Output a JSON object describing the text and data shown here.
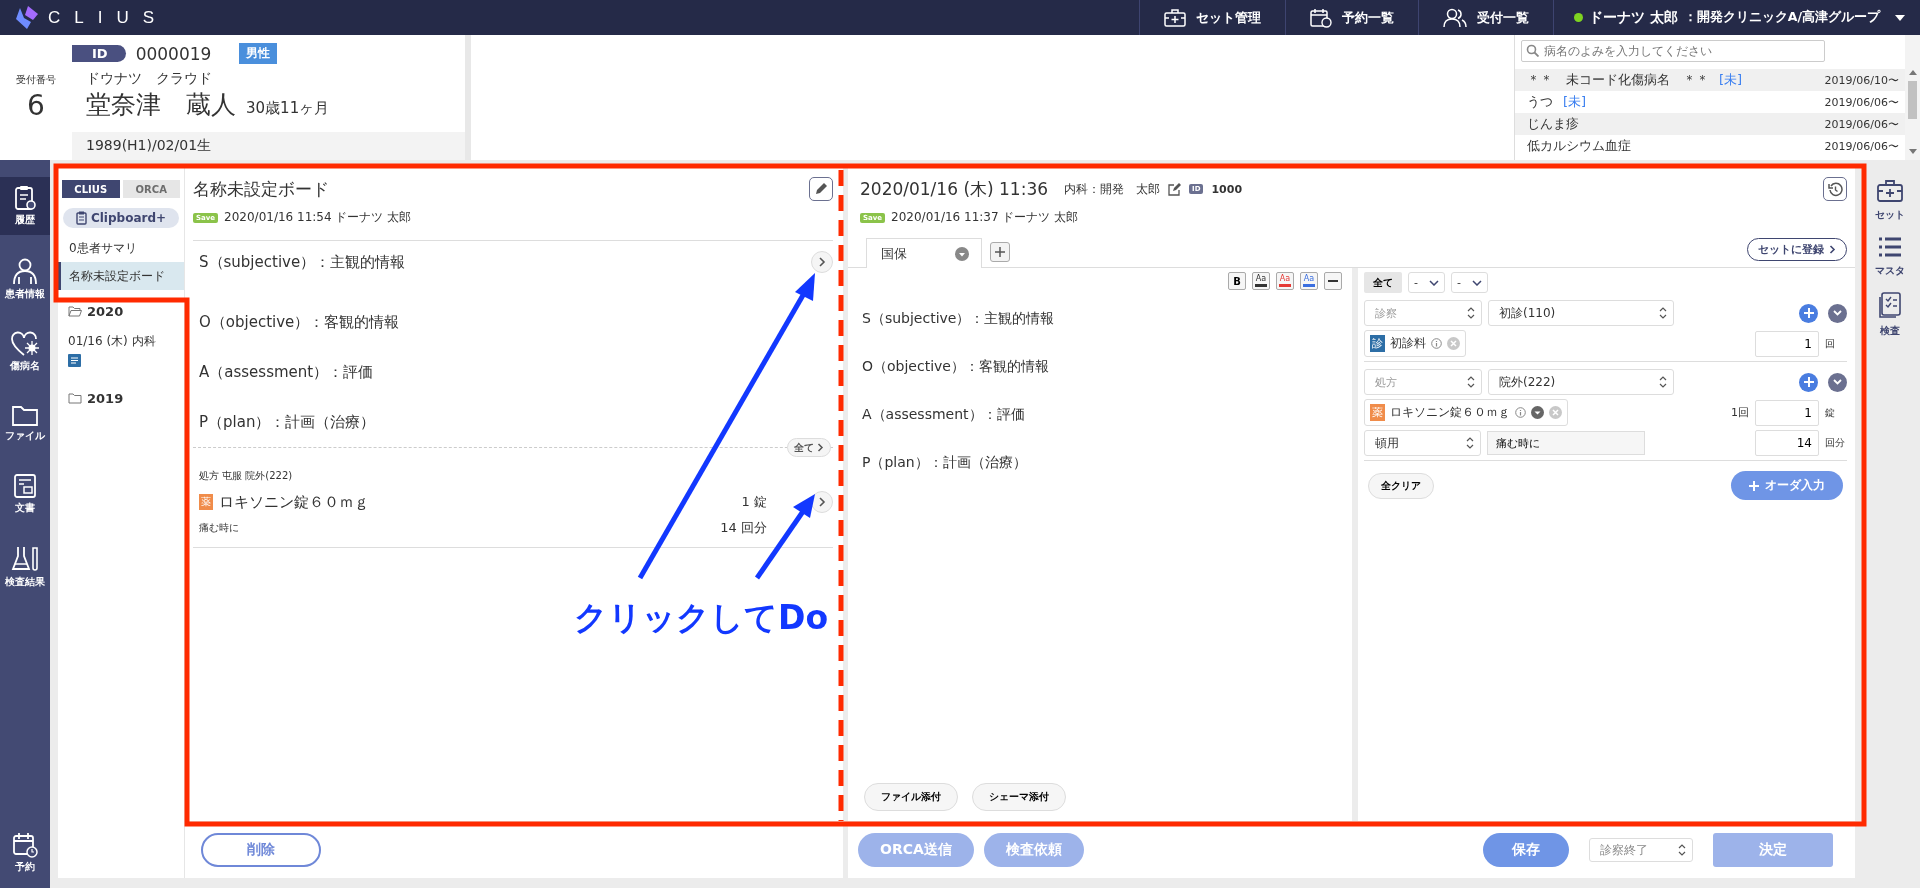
{
  "top_bar": {
    "logo": "CLIUS",
    "nav": [
      {
        "label": "セット管理",
        "kind": "kit"
      },
      {
        "label": "予約一覧",
        "kind": "calendar"
      },
      {
        "label": "受付一覧",
        "kind": "people"
      }
    ],
    "user": {
      "name": "ドーナツ 太郎",
      "affiliation": "：開発クリニックA/高津グループ",
      "online": true
    }
  },
  "header": {
    "receipt": {
      "label": "受付番号",
      "number": "6"
    },
    "patient": {
      "id_label": "ID",
      "id": "0000019",
      "sex": "男性",
      "kana": "ドウナツ　クラウド",
      "name": "堂奈津　蔵人",
      "age": "30歳11ヶ月",
      "birth": "1989(H1)/02/01生"
    },
    "diseases": {
      "placeholder": "病名のよみを入力してください",
      "rows": [
        {
          "name": "＊＊　未コード化傷病名　＊＊",
          "tag": "[未]",
          "date": "2019/06/10〜"
        },
        {
          "name": "うつ",
          "tag": "[未]",
          "date": "2019/06/06〜"
        },
        {
          "name": "じんま疹",
          "date": "2019/06/06〜"
        },
        {
          "name": "低カルシウム血症",
          "date": "2019/06/06〜"
        }
      ]
    }
  },
  "left_nav": {
    "items": [
      {
        "label": "履歴",
        "kind": "history",
        "selected": true
      },
      {
        "label": "患者情報",
        "kind": "patient",
        "selected": false
      },
      {
        "label": "傷病名",
        "kind": "disease",
        "selected": false
      },
      {
        "label": "ファイル",
        "kind": "folder",
        "selected": false
      },
      {
        "label": "文書",
        "kind": "document",
        "selected": false
      },
      {
        "label": "検査結果",
        "kind": "lab",
        "selected": false
      }
    ],
    "bottom": {
      "label": "予約",
      "kind": "calendar"
    }
  },
  "history_panel": {
    "tabs": [
      {
        "label": "CLIUS",
        "selected": true
      },
      {
        "label": "ORCA",
        "selected": false
      }
    ],
    "clipboard_button": "Clipboard+",
    "items": [
      {
        "label": "0患者サマリ",
        "selected": false
      },
      {
        "label": "名称未設定ボード",
        "selected": true
      }
    ],
    "folders": [
      {
        "label": "2020",
        "expanded": true,
        "children": [
          {
            "label": "01/16 (木)  内科",
            "badge": true
          }
        ]
      },
      {
        "label": "2019",
        "expanded": false
      }
    ]
  },
  "board": {
    "title": "名称未設定ボード",
    "save_badge": "Save",
    "saved": "2020/01/16 11:54 ドーナツ 太郎",
    "soap": [
      "S（subjective）：主観的情報",
      "O（objective）：客観的情報",
      "A（assessment）：評価",
      "P（plan）：計画（治療）"
    ],
    "all_button": "全て",
    "order": {
      "header": "処方 屯服 院外(222)",
      "icon": "薬",
      "drug": "ロキソニン錠６０ｍｇ",
      "dose": "1 錠",
      "usage": "痛む時に",
      "days": "14 回分"
    },
    "delete_button": "削除"
  },
  "karte": {
    "date": "2020/01/16 (木) 11:36",
    "doctor": "内科：開発　太郎",
    "id_label": "ID",
    "id": "1000",
    "save_badge": "Save",
    "saved": "2020/01/16 11:37 ドーナツ 太郎",
    "tabs": [
      {
        "label": "国保",
        "selected": true
      }
    ],
    "register_button": "セットに登録",
    "toolbar": [
      {
        "kind": "bold",
        "label": "B"
      },
      {
        "kind": "font",
        "label": "Aa",
        "color": "#333333"
      },
      {
        "kind": "font",
        "label": "Aa",
        "color": "#e53935"
      },
      {
        "kind": "font",
        "label": "Aa",
        "color": "#3b6fe0"
      },
      {
        "kind": "rule"
      }
    ],
    "soap": [
      "S（subjective）：主観的情報",
      "O（objective）：客観的情報",
      "A（assessment）：評価",
      "P（plan）：計画（治療）"
    ],
    "attach_buttons": [
      "ファイル添付",
      "シェーマ添付"
    ],
    "orders": {
      "all_button": "全て",
      "filters": [
        "-",
        "-"
      ],
      "groups": [
        {
          "category": "診察",
          "type": "初診(110)",
          "items": [
            {
              "icon": "診",
              "color": "#2d6ea6",
              "name": "初診料",
              "menu": false,
              "qty": "1",
              "unit": "回"
            }
          ]
        },
        {
          "category": "処方",
          "type": "院外(222)",
          "items": [
            {
              "icon": "薬",
              "color": "#f08c4a",
              "name": "ロキソニン錠６０ｍｇ",
              "menu": true,
              "per": "1回",
              "qty": "1",
              "unit": "錠",
              "usage": "頓用",
              "comment": "痛む時に",
              "days": "14",
              "days_unit": "回分"
            }
          ]
        }
      ],
      "clear_button": "全クリア",
      "order_button": "オーダ入力"
    },
    "footer": {
      "send_buttons": [
        {
          "label": "ORCA送信",
          "disabled": true
        },
        {
          "label": "検査依頼",
          "disabled": true
        }
      ],
      "save_button": {
        "label": "保存",
        "disabled": false
      },
      "status": "診察終了",
      "decide_button": {
        "label": "決定",
        "disabled": true
      }
    }
  },
  "right_rail": [
    {
      "label": "セット",
      "kind": "kit"
    },
    {
      "label": "マスタ",
      "kind": "list"
    },
    {
      "label": "検査",
      "kind": "checklist"
    }
  ],
  "annotation": {
    "text": "クリックしてDo"
  }
}
